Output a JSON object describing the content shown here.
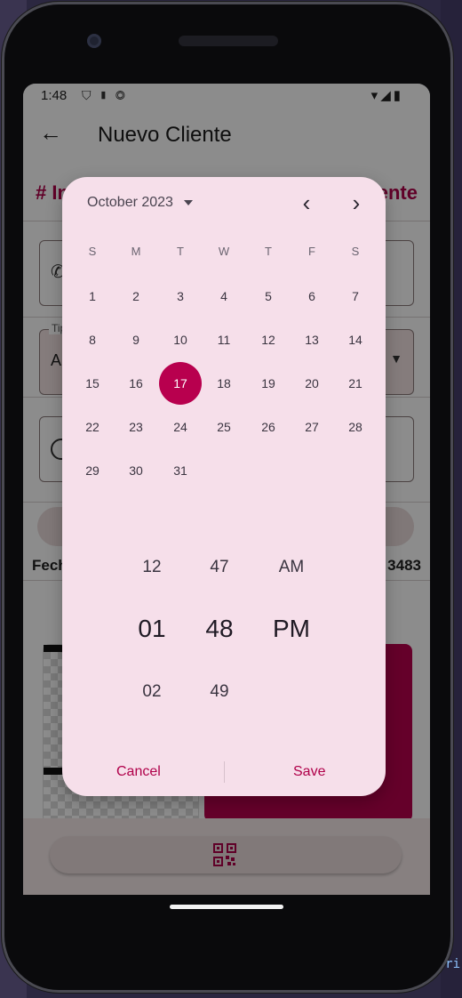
{
  "status_bar": {
    "time": "1:48"
  },
  "app_bar": {
    "title": "Nuevo Cliente",
    "back_icon": "arrow-left-icon"
  },
  "background": {
    "section_title_left": "# In",
    "section_title_right": "ente",
    "select_label": "Tip",
    "select_value": "Al",
    "fecha_label": "Fech",
    "fecha_value": "3483"
  },
  "dialog": {
    "month_label": "October 2023",
    "weekdays": [
      "S",
      "M",
      "T",
      "W",
      "T",
      "F",
      "S"
    ],
    "days": [
      "1",
      "2",
      "3",
      "4",
      "5",
      "6",
      "7",
      "8",
      "9",
      "10",
      "11",
      "12",
      "13",
      "14",
      "15",
      "16",
      "17",
      "18",
      "19",
      "20",
      "21",
      "22",
      "23",
      "24",
      "25",
      "26",
      "27",
      "28",
      "29",
      "30",
      "31"
    ],
    "first_weekday_index": 0,
    "selected_day": "17",
    "time_picker": {
      "hours": [
        "12",
        "01",
        "02"
      ],
      "minutes": [
        "47",
        "48",
        "49"
      ],
      "period": [
        "AM",
        "PM"
      ],
      "selected_hour": "01",
      "selected_minute": "48",
      "selected_period": "PM"
    },
    "cancel_label": "Cancel",
    "save_label": "Save"
  },
  "colors": {
    "accent": "#b8004e",
    "dialog_bg": "#f6dfea"
  }
}
